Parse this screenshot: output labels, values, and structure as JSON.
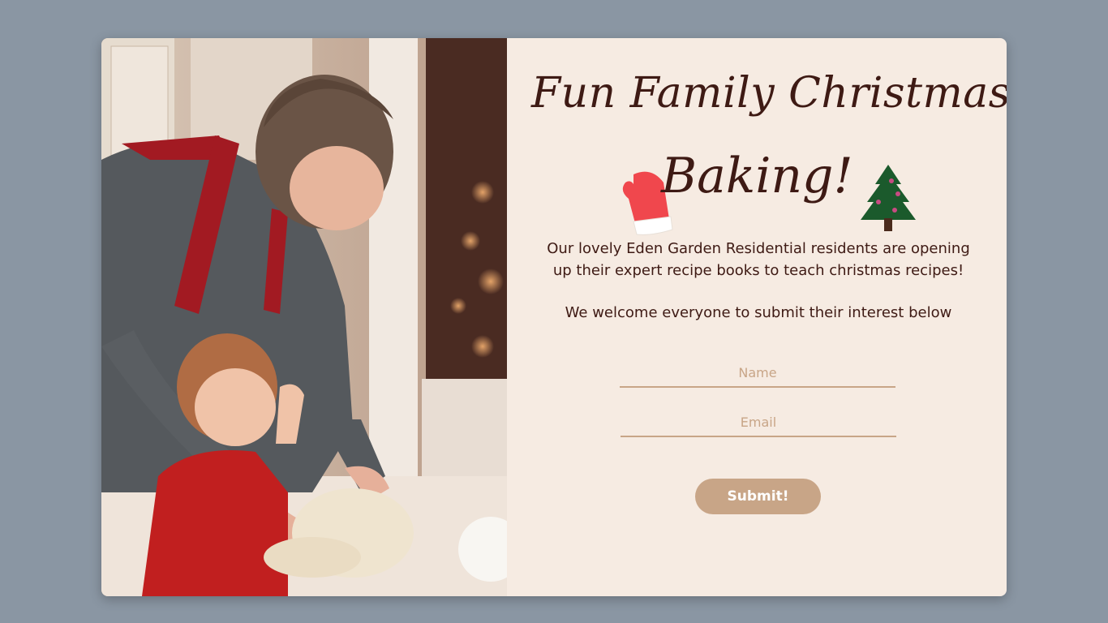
{
  "hero": {
    "image_alt": "Grandmother and child kneading dough together"
  },
  "title": {
    "line1": "Fun Family Christmas",
    "line2": "Baking!"
  },
  "icons": {
    "mitten": "mitten-icon",
    "tree": "christmas-tree-icon"
  },
  "description": {
    "paragraph1": "Our lovely Eden Garden Residential residents are opening up their expert recipe books to teach christmas recipes!",
    "paragraph2": "We welcome everyone to submit their interest below"
  },
  "form": {
    "name_placeholder": "Name",
    "email_placeholder": "Email",
    "submit_label": "Submit!"
  },
  "colors": {
    "page_background": "#8a96a3",
    "card_background": "#f6ebe2",
    "accent": "#c8a587",
    "text": "#3e1a14"
  }
}
